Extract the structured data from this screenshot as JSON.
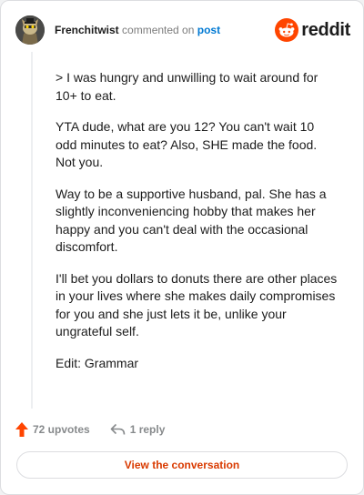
{
  "comment": {
    "username": "Frenchitwist",
    "action_text": "commented on",
    "post_link_text": "post",
    "paragraphs": [
      "> I was hungry and unwilling to wait around for 10+ to eat.",
      "YTA dude, what are you 12? You can't wait 10 odd minutes to eat? Also, SHE made the food. Not you.",
      "Way to be a supportive husband, pal. She has a slightly inconveniencing hobby that makes her happy and you can't deal with the occasional discomfort.",
      "I'll bet you dollars to donuts there are other places in your lives where she makes daily compromises for you and she just lets it be, unlike your ungrateful self.",
      "Edit: Grammar"
    ]
  },
  "brand": {
    "wordmark": "reddit",
    "icon": "reddit-alien-icon",
    "color": "#ff4500"
  },
  "stats": {
    "upvotes": "72 upvotes",
    "replies": "1 reply",
    "upvote_icon": "upvote-arrow-icon",
    "reply_icon": "reply-arrow-icon",
    "upvote_color": "#ff4500"
  },
  "cta": {
    "label": "View the conversation",
    "color": "#d93a00"
  }
}
